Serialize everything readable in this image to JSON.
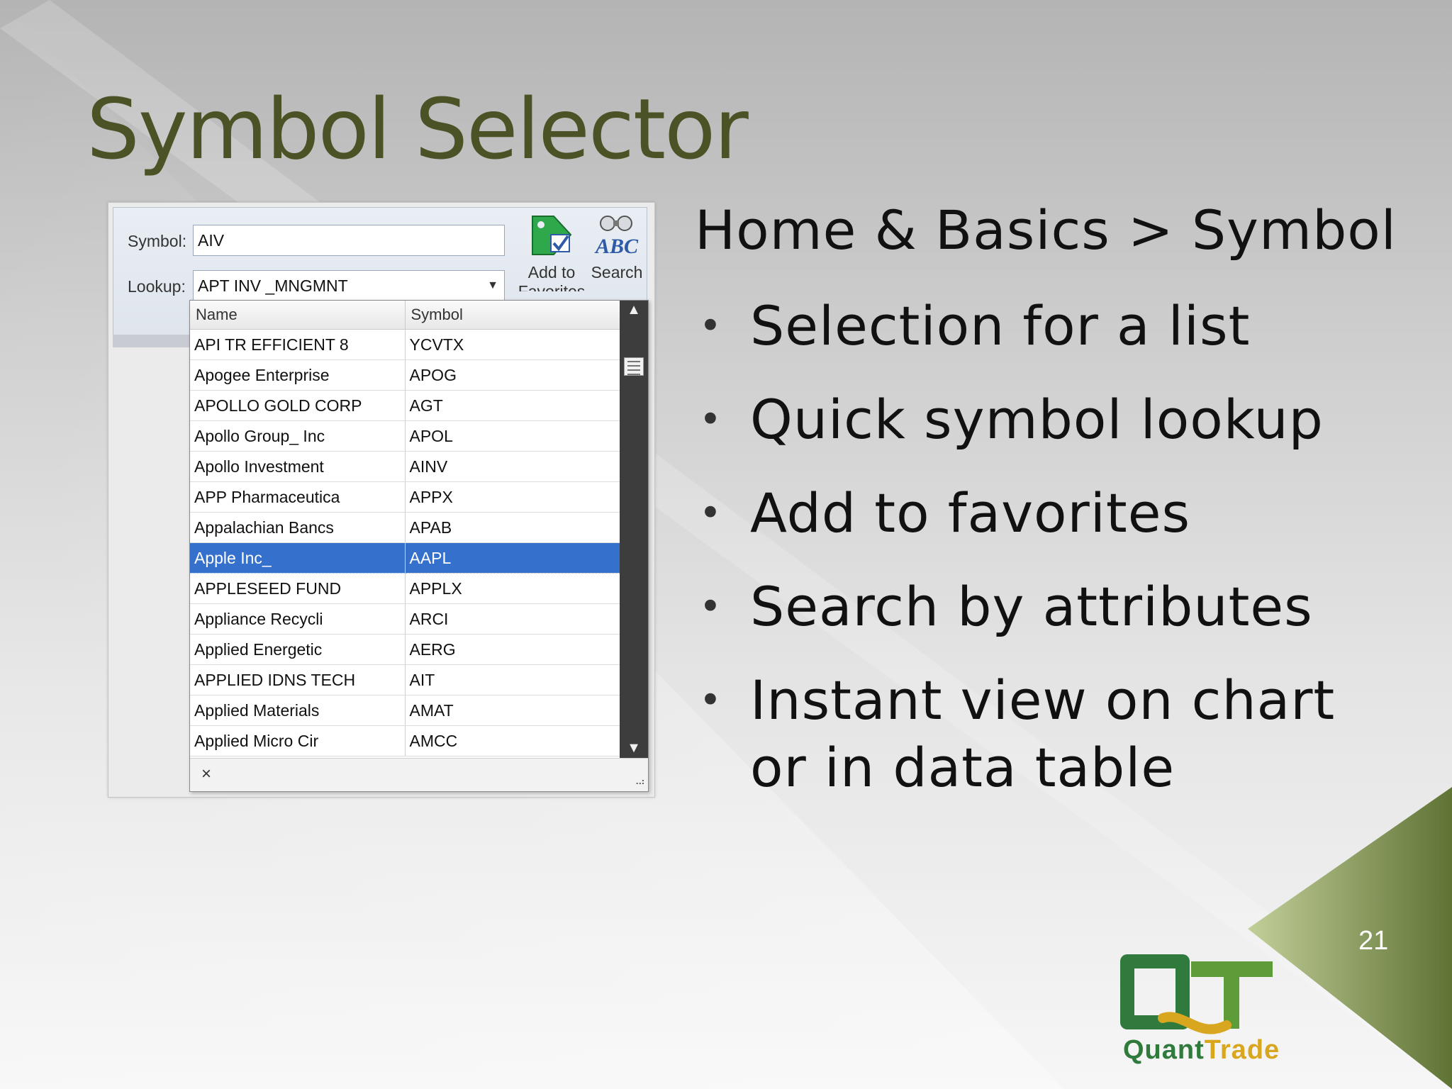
{
  "slide": {
    "title": "Symbol Selector",
    "heading": "Home & Basics > Symbol",
    "bullets": [
      "Selection for a list",
      "Quick symbol lookup",
      "Add to favorites",
      "Search by attributes",
      "Instant view on chart or in data table"
    ],
    "page_number": "21"
  },
  "selector": {
    "symbol_label": "Symbol:",
    "symbol_value": "AIV",
    "lookup_label": "Lookup:",
    "lookup_value": "APT INV _MNGMNT",
    "add_favorites_label": "Add to Favorites",
    "search_label": "Search",
    "columns": [
      "Name",
      "Symbol"
    ],
    "rows": [
      {
        "name": "API TR EFFICIENT 8",
        "symbol": "YCVTX"
      },
      {
        "name": "Apogee Enterprise",
        "symbol": "APOG"
      },
      {
        "name": "APOLLO GOLD CORP",
        "symbol": "AGT"
      },
      {
        "name": "Apollo Group_ Inc",
        "symbol": "APOL"
      },
      {
        "name": "Apollo Investment",
        "symbol": "AINV"
      },
      {
        "name": "APP Pharmaceutica",
        "symbol": "APPX"
      },
      {
        "name": "Appalachian Bancs",
        "symbol": "APAB"
      },
      {
        "name": "Apple Inc_",
        "symbol": "AAPL"
      },
      {
        "name": "APPLESEED FUND",
        "symbol": "APPLX"
      },
      {
        "name": "Appliance Recycli",
        "symbol": "ARCI"
      },
      {
        "name": "Applied Energetic",
        "symbol": "AERG"
      },
      {
        "name": "APPLIED IDNS TECH",
        "symbol": "AIT"
      },
      {
        "name": "Applied Materials",
        "symbol": "AMAT"
      },
      {
        "name": "Applied Micro Cir",
        "symbol": "AMCC"
      }
    ],
    "selected_symbol": "AAPL",
    "close_label": "×"
  },
  "logo": {
    "text_part1": "Quant",
    "text_part2": "Trade",
    "green": "#2f7a3c",
    "gold": "#d8a71f"
  },
  "colors": {
    "title": "#4a5226",
    "selection": "#3470cc",
    "corner": "#6e8440"
  }
}
